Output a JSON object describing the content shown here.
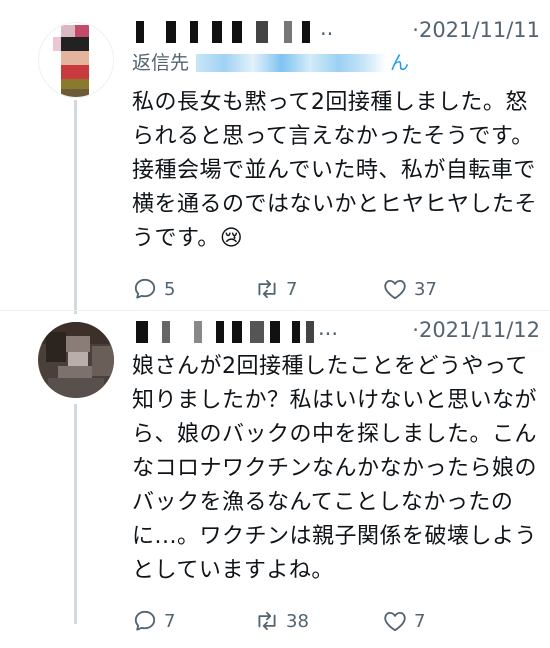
{
  "tweets": [
    {
      "meta": "·2021/11/11",
      "name_tail": "..",
      "reply_prefix": "返信先",
      "reply_handle_tail": "ん",
      "text": "私の長女も黙って2回接種しました。怒られると思って言えなかったそうです。接種会場で並んでいた時、私が自転車で横を通るのではないかとヒヤヒヤしたそうです。😢",
      "replies": "5",
      "retweets": "7",
      "likes": "37"
    },
    {
      "meta": "·2021/11/12",
      "name_tail": "...",
      "text": "娘さんが2回接種したことをどうやって知りましたか？私はいけないと思いながら、娘のバックの中を探しました。こんなコロナワクチンなんかなかったら娘のバックを漁るなんてことしなかったのに...。ワクチンは親子関係を破壊しようとしていますよね。",
      "replies": "7",
      "retweets": "38",
      "likes": "7"
    }
  ],
  "icons": [
    "reply-icon",
    "retweet-icon",
    "like-icon"
  ]
}
